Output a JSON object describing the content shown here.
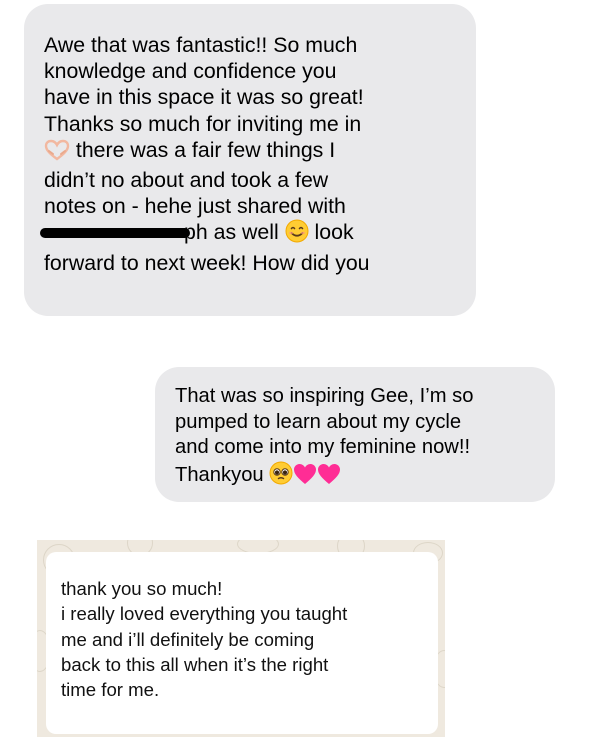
{
  "message1": {
    "lines": [
      "Awe that was fantastic!! So much",
      "knowledge and confidence you",
      "have in this space it was so great!",
      "Thanks so much for inviting me in",
      "there was a fair few things I",
      "didn’t no about and took a few",
      "notes on - hehe just shared with",
      "ph as well",
      "look",
      "forward to next week! How did you"
    ],
    "emoji_1": "heart-hands-emoji",
    "emoji_2": "smiling-face-emoji"
  },
  "message2": {
    "lines": [
      "That was so inspiring Gee, I’m so",
      "pumped to learn about my cycle",
      "and come into my feminine now!!",
      "Thankyou"
    ],
    "emojis": [
      "pleading-face-emoji",
      "pink-heart-emoji",
      "pink-heart-emoji"
    ],
    "colors": {
      "bubble": "#e9e9eb",
      "heart": "#ff2d95"
    }
  },
  "message3": {
    "lines": [
      "thank you so much!",
      "i really loved everything you taught",
      "me and i’ll definitely be coming",
      "back to this all when it’s the right",
      "time for me."
    ],
    "colors": {
      "background": "#efe9df",
      "bubble": "#ffffff"
    }
  }
}
